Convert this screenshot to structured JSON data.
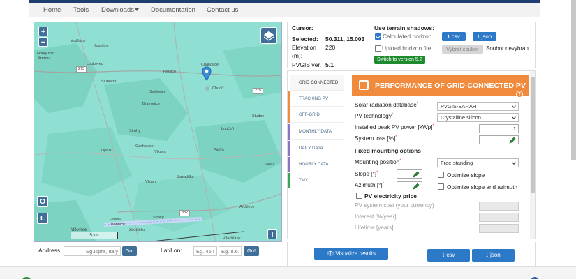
{
  "nav": {
    "items": [
      "Home",
      "Tools",
      "Downloads",
      "Documentation",
      "Contact us"
    ]
  },
  "map": {
    "zoom_in": "+",
    "zoom_out": "−",
    "btn_o": "O",
    "btn_l": "L",
    "btn_i": "I",
    "scale": "5 km",
    "places": [
      "Vodňany",
      "Kosořice",
      "Horky nad Jizerou",
      "Loukovec",
      "Rejšice",
      "Chárvatce",
      "Sluněčín",
      "Smilovice",
      "Chudíř",
      "Bratronice",
      "Studce",
      "Struhy",
      "Loučeň",
      "Čachovice",
      "Lipník",
      "Vlkava",
      "Pátřín",
      "Jíkev",
      "Vlkavy",
      "Zavadilka",
      "Straky",
      "Archleby",
      "Milovice",
      "Zbožíčko",
      "Všechlapy",
      "Lenora",
      "Bobnice"
    ],
    "roads": [
      "275",
      "275",
      "332"
    ]
  },
  "address": {
    "label": "Address:",
    "placeholder": "Eg.Ispra, Italy",
    "go": "Go!",
    "latlon_label": "Lat/Lon:",
    "lat_placeholder": "Eg. 45.8",
    "lon_placeholder": "Eg. 8.61",
    "go2": "Go!"
  },
  "cursor": {
    "cursor_label": "Cursor:",
    "selected_label": "Selected:",
    "selected_value": "50.311, 15.003",
    "elevation_label": "Elevation",
    "elevation_unit": "(m):",
    "elevation_value": "220",
    "version_label": "PVGIS ver.",
    "version_value": "5.1"
  },
  "terrain": {
    "title": "Use terrain shadows:",
    "calc_horizon": "Calculated horizon",
    "calc_checked": true,
    "upload_horizon": "Upload horizon file",
    "csv": "csv",
    "json": "json",
    "choose_file": "Vybrat soubor",
    "no_file": "Soubor nevybrán",
    "switch": "Switch to version 5.2"
  },
  "tabs": [
    {
      "label": "GRID CONNECTED",
      "color": "#f08a3c",
      "active": true
    },
    {
      "label": "TRACKING PV",
      "color": "#f08a3c",
      "active": false
    },
    {
      "label": "OFF-GRID",
      "color": "#f08a3c",
      "active": false
    },
    {
      "label": "MONTHLY DATA",
      "color": "#8a73c0",
      "active": false
    },
    {
      "label": "DAILY DATA",
      "color": "#8a73c0",
      "active": false
    },
    {
      "label": "HOURLY DATA",
      "color": "#8a73c0",
      "active": false
    },
    {
      "label": "TMY",
      "color": "#3aa55a",
      "active": false
    }
  ],
  "form": {
    "title": "PERFORMANCE OF GRID-CONNECTED PV",
    "help": "?",
    "radiation_label": "Solar radiation database",
    "radiation_value": "PVGIS-SARAH",
    "tech_label": "PV technology",
    "tech_value": "Crystalline silicon",
    "power_label": "Installed peak PV power [kWp]",
    "power_value": "1",
    "loss_label": "System loss [%]",
    "fixed_head": "Fixed mounting options",
    "mount_label": "Mounting position",
    "mount_value": "Free-standing",
    "slope_label": "Slope [°]",
    "azimuth_label": "Azimuth [°]",
    "opt_slope": "Optimize slope",
    "opt_slope_az": "Optimize slope and azimuth",
    "price_head": "PV electricity price",
    "cost_label": "PV system cost (your currency)",
    "interest_label": "Interest [%/year]",
    "lifetime_label": "Lifetime [years]"
  },
  "bottom": {
    "visualize": "Visualize results",
    "csv": "csv",
    "json": "json"
  }
}
